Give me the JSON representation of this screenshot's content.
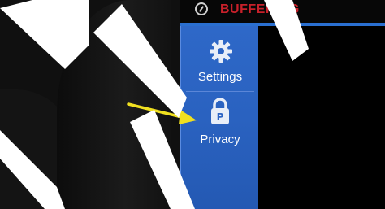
{
  "top_bar": {
    "status_text": "BUFFERING",
    "status_color": "#c8202a",
    "status_icon": "compass-icon"
  },
  "menu": {
    "items": [
      {
        "label": "Settings",
        "icon": "gear-icon"
      },
      {
        "label": "Privacy",
        "icon": "lock-icon",
        "icon_letter": "P"
      }
    ]
  },
  "annotation": {
    "arrow_color": "#f0e020",
    "points_to": "Privacy"
  },
  "colors": {
    "menu_blue": "#2a62c0",
    "accent_line": "#2a6fd0"
  }
}
